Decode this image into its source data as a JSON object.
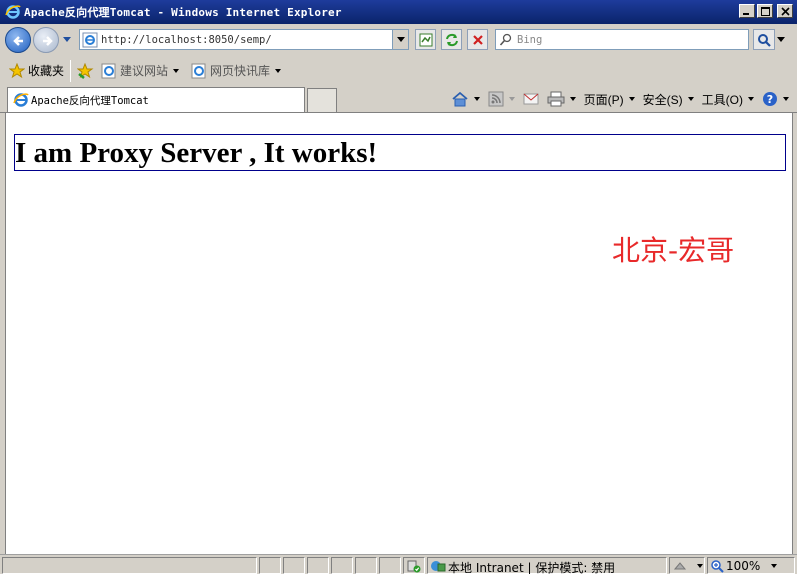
{
  "window": {
    "title": "Apache反向代理Tomcat - Windows Internet Explorer"
  },
  "address_bar": {
    "url": "http://localhost:8050/semp/",
    "search_placeholder": "Bing"
  },
  "favorites_bar": {
    "favorites_label": "收藏夹",
    "suggested_sites_label": "建议网站",
    "web_slice_gallery_label": "网页快讯库"
  },
  "tab": {
    "label": "Apache反向代理Tomcat"
  },
  "command_bar": {
    "page_label": "页面(P)",
    "safety_label": "安全(S)",
    "tools_label": "工具(O)"
  },
  "page": {
    "heading": "I am Proxy Server , It works!",
    "watermark": "北京-宏哥"
  },
  "status_bar": {
    "zone_text": "本地 Intranet | 保护模式: 禁用",
    "zoom": "100%"
  },
  "colors": {
    "titlebar": "#0a246a",
    "heading_border": "#00008b",
    "watermark": "#e8292a"
  }
}
